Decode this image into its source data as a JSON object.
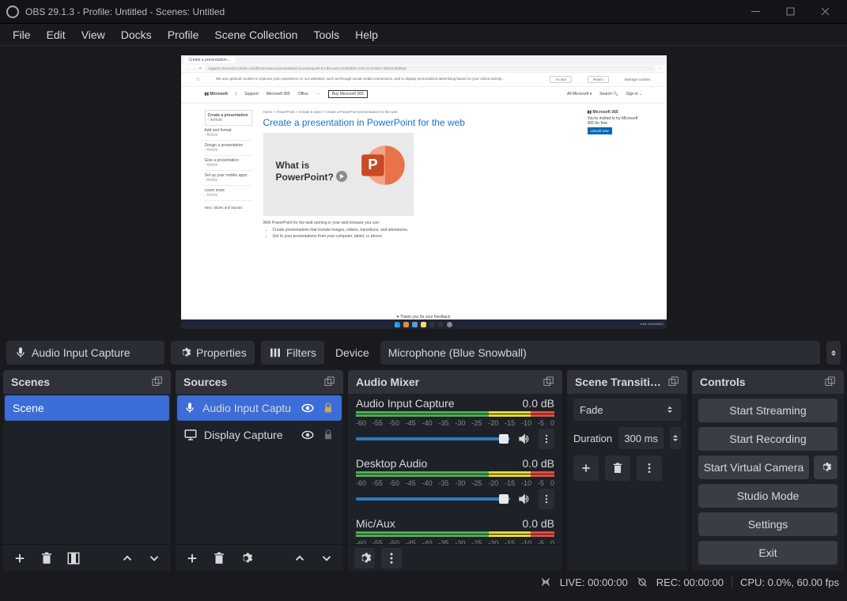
{
  "titlebar": {
    "title": "OBS 29.1.3 - Profile: Untitled - Scenes: Untitled"
  },
  "menu": [
    "File",
    "Edit",
    "View",
    "Docks",
    "Profile",
    "Scene Collection",
    "Tools",
    "Help"
  ],
  "preview": {
    "tab": "Create a presentation...",
    "url": "support.microsoft.com/en-us/office/create-a-presentation-in-powerpoint-for-the-web-21360025-7eef-4173-9d7c-08281d55f64a",
    "infobar_msg": "We use optional cookies to improve your experience on our websites, such as through social media connections, and to display personalized advertising based on your online activity...",
    "infobar_accept": "Accept",
    "infobar_reject": "Reject",
    "infobar_manage": "Manage cookies",
    "crumb": "Home > PowerPoint > Create & save > Create a PowerPoint presentation for the web",
    "heading": "Create a presentation in PowerPoint for the web",
    "video_line1": "What is",
    "video_line2": "PowerPoint?",
    "under_title": "With PowerPoint for the web running in your web browser you can:",
    "under_b1": "Create presentations that include images, videos, transitions, and animations.",
    "under_b2": "Get to your presentations from your computer, tablet, or phone.",
    "right_title": "Microsoft 365",
    "right_sub": "You're invited to try Microsoft 365 for free",
    "right_btn": "Unlock now",
    "side_items": [
      "Create a presentation",
      "Add and format",
      "Design a presentation",
      "Give a presentation",
      "Set up your mobile apps",
      "Learn more"
    ],
    "footer": "♥ Thank you for your feedback",
    "taskbar_time": "6:53\n12/10/2023"
  },
  "src_toolbar": {
    "selected": "Audio Input Capture",
    "properties": "Properties",
    "filters": "Filters",
    "device_label": "Device",
    "device_value": "Microphone (Blue Snowball)"
  },
  "scenes": {
    "title": "Scenes",
    "items": [
      "Scene"
    ]
  },
  "sources": {
    "title": "Sources",
    "items": [
      {
        "name": "Audio Input Captu",
        "selected": true,
        "locked": true
      },
      {
        "name": "Display Capture",
        "selected": false,
        "locked": true
      }
    ]
  },
  "mixer": {
    "title": "Audio Mixer",
    "ticks": [
      "-60",
      "-55",
      "-50",
      "-45",
      "-40",
      "-35",
      "-30",
      "-25",
      "-20",
      "-15",
      "-10",
      "-5",
      "0"
    ],
    "channels": [
      {
        "name": "Audio Input Capture",
        "db": "0.0 dB"
      },
      {
        "name": "Desktop Audio",
        "db": "0.0 dB"
      },
      {
        "name": "Mic/Aux",
        "db": "0.0 dB"
      }
    ]
  },
  "transitions": {
    "title": "Scene Transiti…",
    "value": "Fade",
    "duration_label": "Duration",
    "duration_value": "300 ms"
  },
  "controls": {
    "title": "Controls",
    "start_streaming": "Start Streaming",
    "start_recording": "Start Recording",
    "start_vcam": "Start Virtual Camera",
    "studio_mode": "Studio Mode",
    "settings": "Settings",
    "exit": "Exit"
  },
  "status": {
    "live": "LIVE: 00:00:00",
    "rec": "REC: 00:00:00",
    "cpu": "CPU: 0.0%, 60.00 fps"
  }
}
